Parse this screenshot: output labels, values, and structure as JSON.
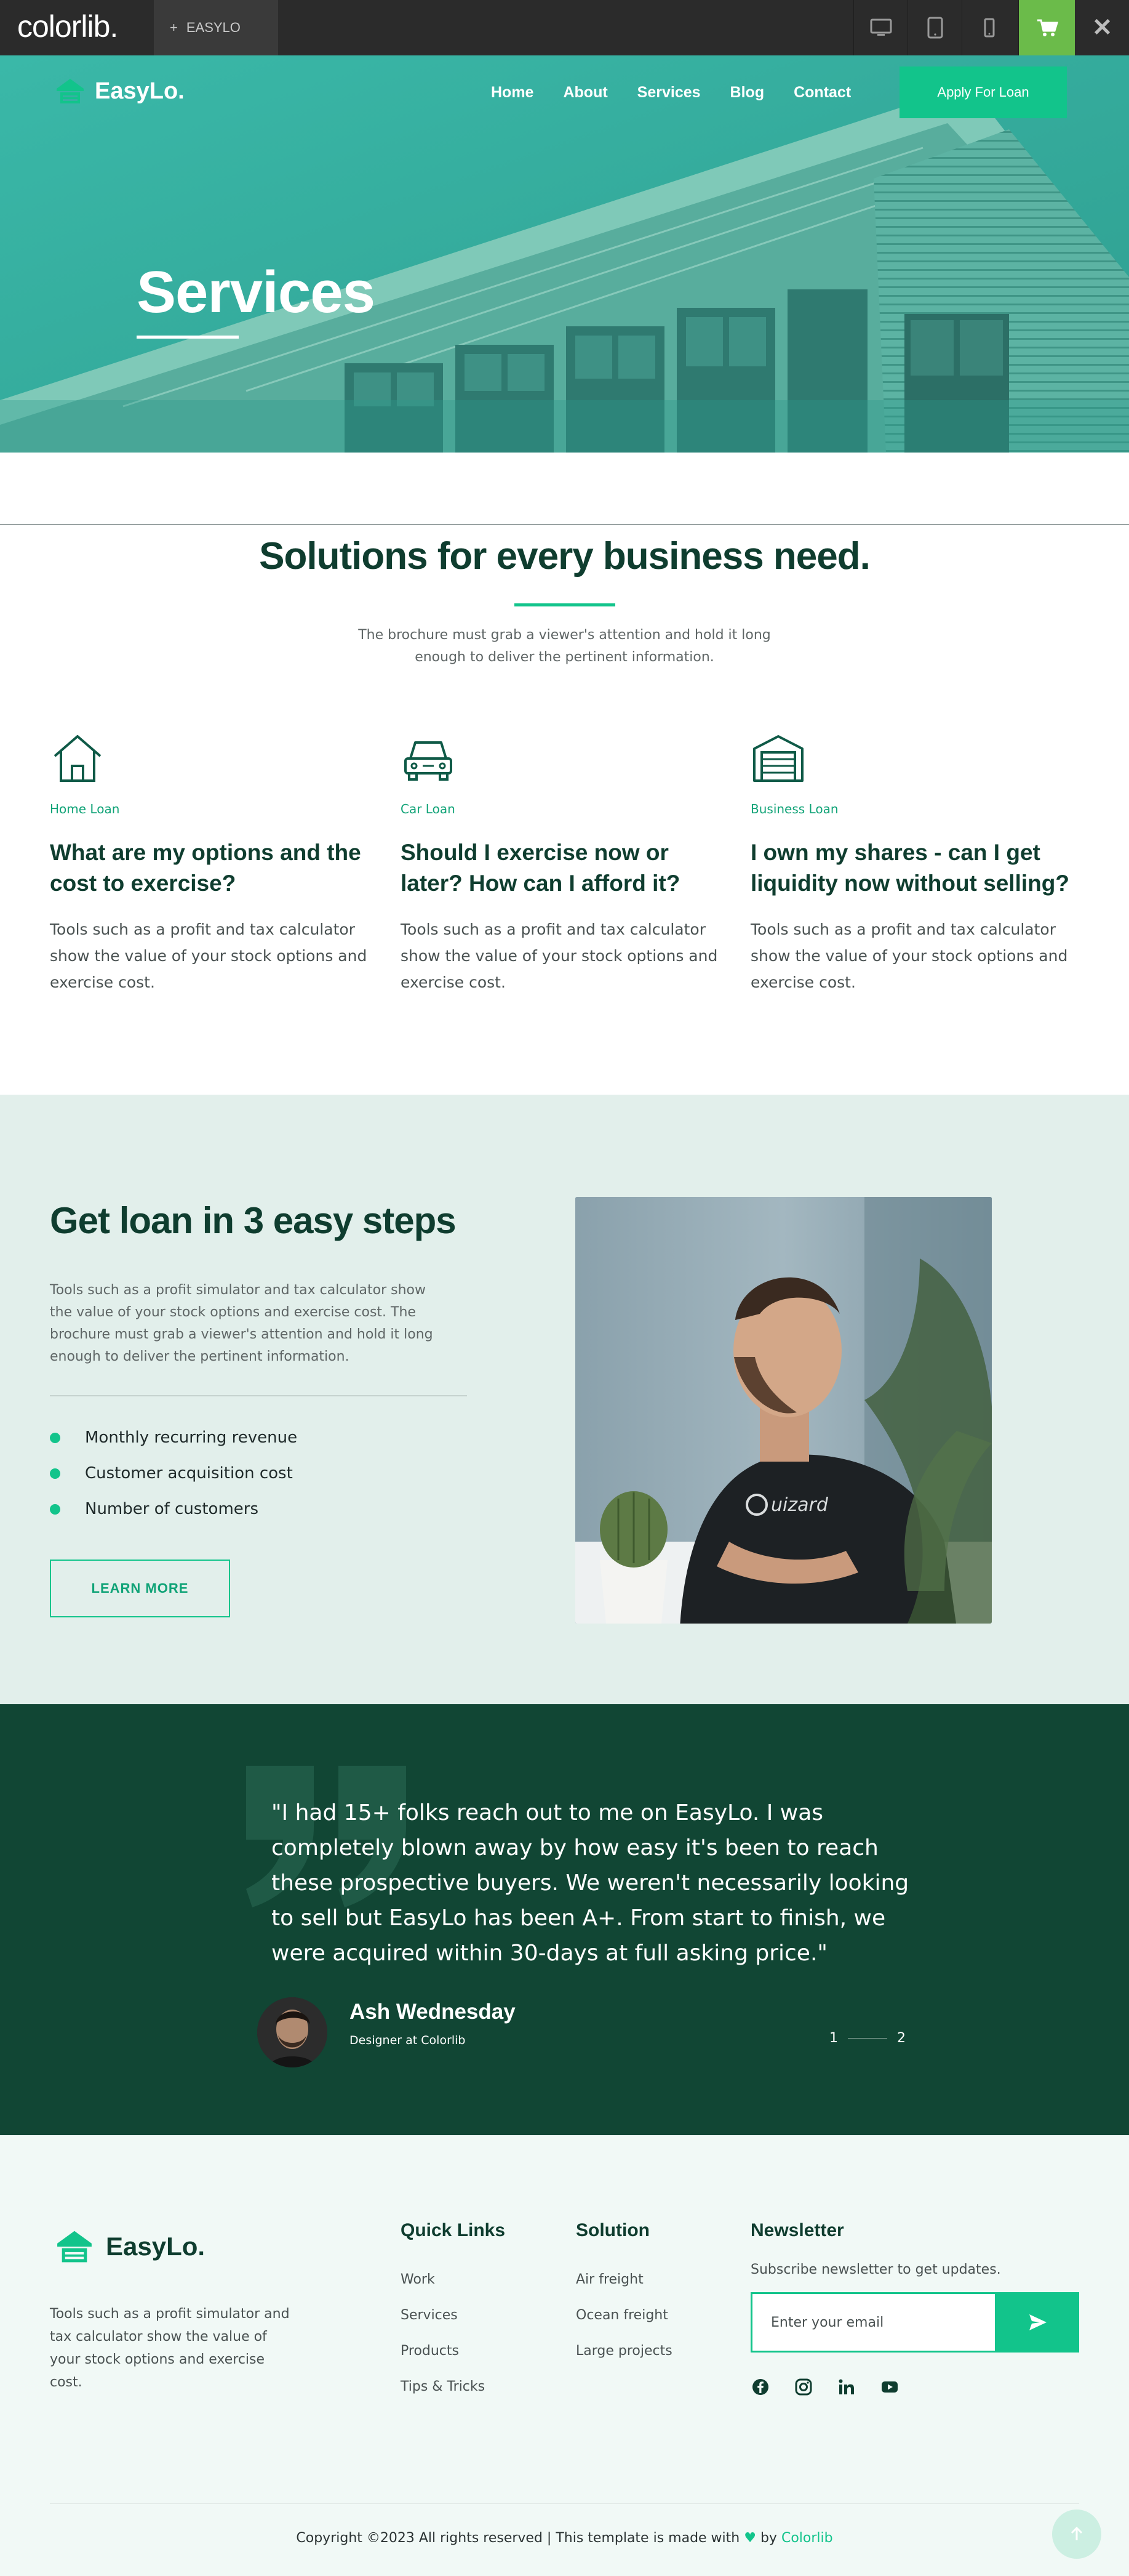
{
  "preview_bar": {
    "logo": "colorlib.",
    "tab_plus": "+",
    "tab_label": "EASYLO",
    "devices": [
      "desktop-icon",
      "tablet-icon",
      "mobile-icon"
    ],
    "cart_icon": "cart-icon",
    "close_label": "✕"
  },
  "header": {
    "brand": "EasyLo.",
    "nav": [
      "Home",
      "About",
      "Services",
      "Blog",
      "Contact"
    ],
    "cta": "Apply For Loan"
  },
  "hero": {
    "title": "Services"
  },
  "solutions": {
    "title": "Solutions for every business need.",
    "subtitle": "The brochure must grab a viewer's attention and hold it long enough to deliver the pertinent information.",
    "cards": [
      {
        "icon": "house-icon",
        "tag": "Home Loan",
        "title": "What are my options and the cost to exercise?",
        "text": "Tools such as a profit and tax calculator show the value of your stock options and exercise cost."
      },
      {
        "icon": "car-icon",
        "tag": "Car Loan",
        "title": "Should I exercise now or later? How can I afford it?",
        "text": "Tools such as a profit and tax calculator show the value of your stock options and exercise cost."
      },
      {
        "icon": "garage-icon",
        "tag": "Business Loan",
        "title": "I own my shares - can I get liquidity now without selling?",
        "text": "Tools such as a profit and tax calculator show the value of your stock options and exercise cost."
      }
    ]
  },
  "steps": {
    "title": "Get loan in 3 easy steps",
    "description": "Tools such as a profit simulator and tax calculator show the value of your stock options and exercise cost. The brochure must grab a viewer's attention and hold it long enough to deliver the pertinent information.",
    "items": [
      "Monthly recurring revenue",
      "Customer acquisition cost",
      "Number of customers"
    ],
    "button": "LEARN MORE",
    "photo_shirt_text": "uizard"
  },
  "testimonial": {
    "quote": "\"I had 15+ folks reach out to me on EasyLo. I was completely blown away by how easy it's been to reach these prospective buyers. We weren't necessarily looking to sell but EasyLo has been A+. From start to finish, we were acquired within 30-days at full asking price.\"",
    "name": "Ash Wednesday",
    "role": "Designer at Colorlib",
    "pages": [
      "1",
      "2"
    ]
  },
  "footer": {
    "brand": "EasyLo.",
    "about": "Tools such as a profit simulator and tax calculator show the value of your stock options and exercise cost.",
    "quick_links": {
      "title": "Quick Links",
      "items": [
        "Work",
        "Services",
        "Products",
        "Tips & Tricks"
      ]
    },
    "solution": {
      "title": "Solution",
      "items": [
        "Air freight",
        "Ocean freight",
        "Large projects"
      ]
    },
    "newsletter": {
      "title": "Newsletter",
      "subtitle": "Subscribe newsletter to get updates.",
      "placeholder": "Enter your email",
      "button_icon": "send-icon"
    },
    "social": [
      "facebook-icon",
      "instagram-icon",
      "linkedin-icon",
      "youtube-icon"
    ],
    "copyright_prefix": "Copyright ©2023 All rights reserved | This template is made with",
    "copyright_by": "by",
    "copyright_link": "Colorlib",
    "heart": "♥"
  },
  "colors": {
    "accent": "#12c48b",
    "dark_green": "#114634",
    "heading": "#0f3d2f",
    "hero_teal": "#36b1a2",
    "steps_bg": "#e2efeb",
    "footer_bg": "#f1f9f6"
  }
}
